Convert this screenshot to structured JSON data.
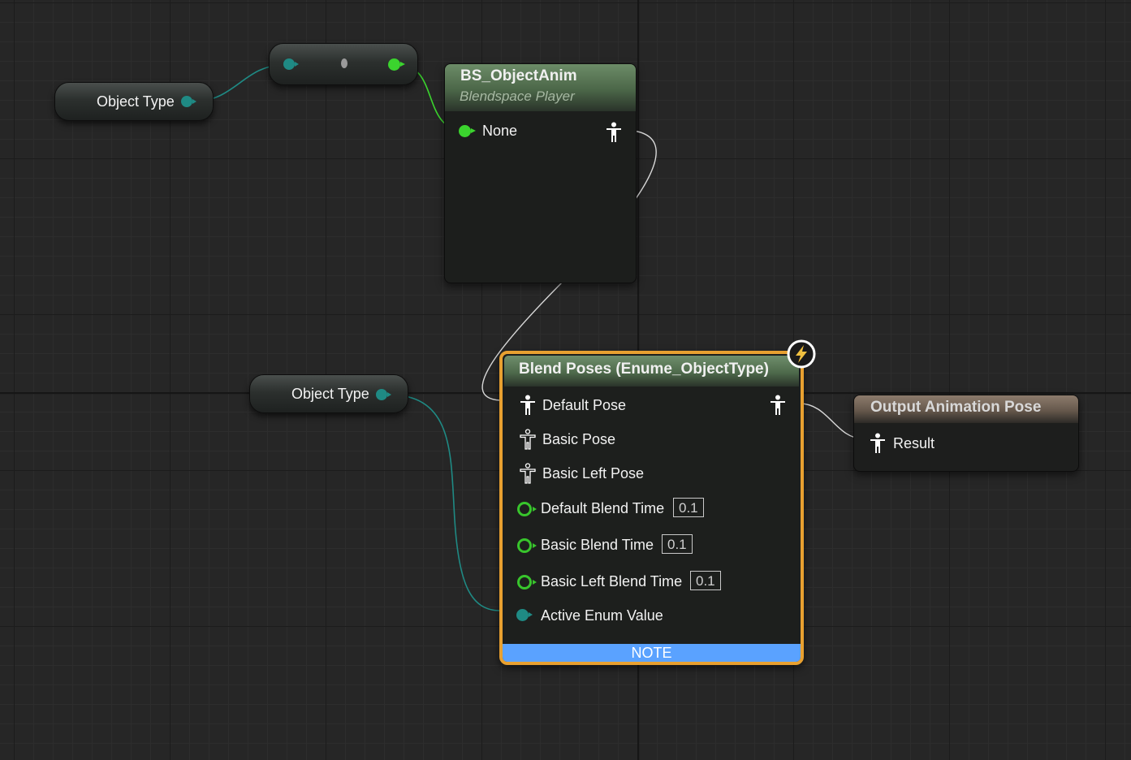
{
  "nodes": {
    "object_type_1": {
      "label": "Object Type"
    },
    "object_type_2": {
      "label": "Object Type"
    },
    "blendspace": {
      "title": "BS_ObjectAnim",
      "subtitle": "Blendspace Player",
      "pin_label": "None"
    },
    "blend_poses": {
      "title": "Blend Poses (Enume_ObjectType)",
      "pins": {
        "default_pose": "Default Pose",
        "basic_pose": "Basic Pose",
        "basic_left_pose": "Basic Left Pose",
        "default_blend_time": "Default Blend Time",
        "default_blend_time_value": "0.1",
        "basic_blend_time": "Basic Blend Time",
        "basic_blend_time_value": "0.1",
        "basic_left_blend_time": "Basic Left Blend Time",
        "basic_left_blend_time_value": "0.1",
        "active_enum_value": "Active Enum Value"
      },
      "footer": "NOTE"
    },
    "output_pose": {
      "title": "Output Animation Pose",
      "pin_label": "Result"
    }
  },
  "colors": {
    "enum_pin": "#1f8a84",
    "bool_pin": "#3bd42e",
    "float_pin": "#38c52c",
    "selection_outline": "#e8a030",
    "note_bar": "#5aa2ff",
    "blend_header": "#5b7a5b",
    "output_header": "#6d6157"
  },
  "icons": {
    "pose": "pose-figure-icon",
    "fast_path": "lightning-icon"
  }
}
